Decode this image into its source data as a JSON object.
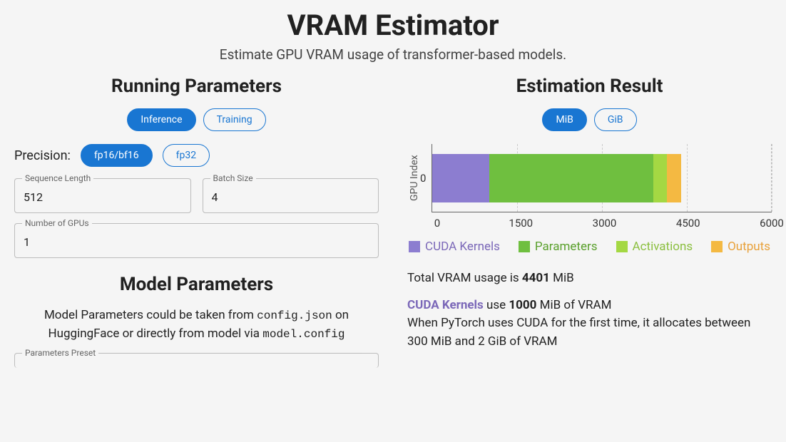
{
  "header": {
    "title": "VRAM Estimator",
    "subtitle": "Estimate GPU VRAM usage of transformer-based models."
  },
  "left": {
    "running_params_title": "Running Parameters",
    "mode": {
      "inference": "Inference",
      "training": "Training"
    },
    "precision_label": "Precision:",
    "precision": {
      "fp16": "fp16/bf16",
      "fp32": "fp32"
    },
    "fields": {
      "seq_len": {
        "label": "Sequence Length",
        "value": "512"
      },
      "batch_size": {
        "label": "Batch Size",
        "value": "4"
      },
      "num_gpus": {
        "label": "Number of GPUs",
        "value": "1"
      }
    },
    "model_params_title": "Model Parameters",
    "model_desc_prefix": "Model Parameters could be taken from ",
    "model_desc_code1": "config.json",
    "model_desc_mid": " on HuggingFace or directly from model via ",
    "model_desc_code2": "model.config",
    "params_preset_label": "Parameters Preset"
  },
  "right": {
    "estimation_title": "Estimation Result",
    "unit": {
      "mib": "MiB",
      "gib": "GiB"
    },
    "y_axis_label": "GPU Index",
    "y_tick": "0",
    "x_ticks": [
      "0",
      "1500",
      "3000",
      "4500",
      "6000"
    ],
    "legend": {
      "cuda": "CUDA Kernels",
      "params": "Parameters",
      "acts": "Activations",
      "outputs": "Outputs"
    },
    "total_line_prefix": "Total VRAM usage is ",
    "total_value": "4401",
    "total_unit": " MiB",
    "cuda_line_label": "CUDA Kernels",
    "cuda_line_mid": " use ",
    "cuda_line_value": "1000",
    "cuda_line_suffix": " MiB of VRAM",
    "cuda_explain": "When PyTorch uses CUDA for the first time, it allocates between 300 MiB and 2 GiB of VRAM"
  },
  "chart_data": {
    "type": "bar",
    "orientation": "horizontal",
    "stacked": true,
    "categories": [
      "0"
    ],
    "xlabel": "",
    "ylabel": "GPU Index",
    "xlim": [
      0,
      6000
    ],
    "x_ticks": [
      0,
      1500,
      3000,
      4500,
      6000
    ],
    "series": [
      {
        "name": "CUDA Kernels",
        "color": "#8c7dd0",
        "values": [
          1000
        ]
      },
      {
        "name": "Parameters",
        "color": "#6fbf3f",
        "values": [
          2900
        ]
      },
      {
        "name": "Activations",
        "color": "#a4d843",
        "values": [
          250
        ]
      },
      {
        "name": "Outputs",
        "color": "#f4b942",
        "values": [
          251
        ]
      }
    ],
    "total": 4401,
    "unit": "MiB"
  }
}
